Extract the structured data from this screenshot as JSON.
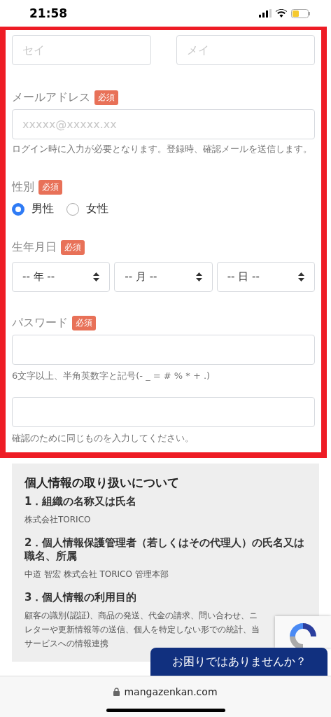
{
  "status_bar": {
    "time": "21:58"
  },
  "form": {
    "name_fields": [
      {
        "placeholder": "セイ"
      },
      {
        "placeholder": "メイ"
      }
    ],
    "email": {
      "label": "メールアドレス",
      "required_badge": "必須",
      "placeholder": "xxxxx@xxxxx.xx",
      "hint": "ログイン時に入力が必要となります。登録時、確認メールを送信します。"
    },
    "gender": {
      "label": "性別",
      "required_badge": "必須",
      "options": [
        {
          "label": "男性",
          "selected": true
        },
        {
          "label": "女性",
          "selected": false
        }
      ]
    },
    "birthdate": {
      "label": "生年月日",
      "required_badge": "必須",
      "selects": [
        {
          "value": "-- 年 --"
        },
        {
          "value": "-- 月 --"
        },
        {
          "value": "-- 日 --"
        }
      ]
    },
    "password": {
      "label": "パスワード",
      "required_badge": "必須",
      "hint": "6文字以上、半角英数字と記号(- _ = # % * + .)"
    },
    "password_confirm": {
      "hint": "確認のために同じものを入力してください。"
    }
  },
  "privacy": {
    "title": "個人情報の取り扱いについて",
    "sections": [
      {
        "heading": "1．組織の名称又は氏名",
        "lines": [
          "株式会社TORICO"
        ]
      },
      {
        "heading": "2．個人情報保護管理者（若しくはその代理人）の氏名又は職名、所属",
        "lines": [
          "中道 智宏 株式会社 TORICO 管理本部"
        ]
      },
      {
        "heading": "3．個人情報の利用目的",
        "lines": [
          "顧客の識別(認証)、商品の発送、代金の請求、問い合わせ、ニ",
          "レターや更新情報等の送信、個人を特定しない形での統計、当",
          "サービスへの情報連携"
        ]
      }
    ]
  },
  "help_button": {
    "label": "お困りではありませんか？"
  },
  "browser_bar": {
    "url": "mangazenkan.com"
  }
}
